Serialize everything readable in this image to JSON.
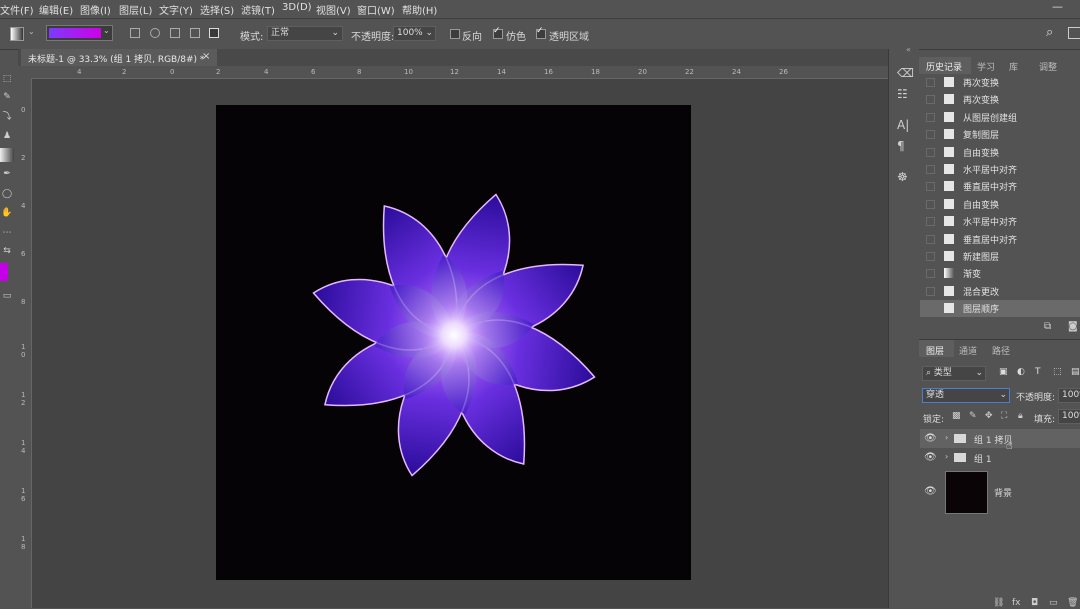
{
  "menubar": {
    "items": [
      "文件(F)",
      "编辑(E)",
      "图像(I)",
      "图层(L)",
      "文字(Y)",
      "选择(S)",
      "滤镜(T)",
      "3D(D)",
      "视图(V)",
      "窗口(W)",
      "帮助(H)"
    ]
  },
  "options": {
    "mode_label": "模式:",
    "mode_value": "正常",
    "opacity_label": "不透明度:",
    "opacity_value": "100%",
    "reverse_label": "反向",
    "dither_label": "仿色",
    "transparency_label": "透明区域",
    "gradient_colors": [
      "#7b3bff",
      "#d000e6"
    ]
  },
  "document": {
    "tab_title": "未标题-1 @ 33.3% (组 1 拷贝, RGB/8#) *",
    "close": "×"
  },
  "rulers": {
    "h": [
      "4",
      "2",
      "0",
      "2",
      "4",
      "6",
      "8",
      "10",
      "12",
      "14",
      "16",
      "18",
      "20",
      "22",
      "24",
      "26"
    ],
    "v": [
      "0",
      "2",
      "4",
      "6",
      "8",
      "1\n0",
      "1\n2",
      "1\n4",
      "1\n6",
      "1\n8"
    ]
  },
  "history": {
    "tabs": [
      "历史记录",
      "学习",
      "库",
      "调整"
    ],
    "items": [
      "再次变换",
      "再次变换",
      "从图层创建组",
      "复制图层",
      "自由变换",
      "水平居中对齐",
      "垂直居中对齐",
      "自由变换",
      "水平居中对齐",
      "垂直居中对齐",
      "新建图层",
      "渐变",
      "混合更改",
      "图层顺序"
    ]
  },
  "layers": {
    "tabs": [
      "图层",
      "通道",
      "路径"
    ],
    "filter_label": "类型",
    "blend_mode": "穿透",
    "opacity_label": "不透明度:",
    "opacity_value": "100%",
    "lock_label": "锁定:",
    "fill_label": "填充:",
    "fill_value": "100%",
    "items": [
      {
        "name": "组 1 拷贝"
      },
      {
        "name": "组 1"
      },
      {
        "name": "背景"
      }
    ]
  }
}
